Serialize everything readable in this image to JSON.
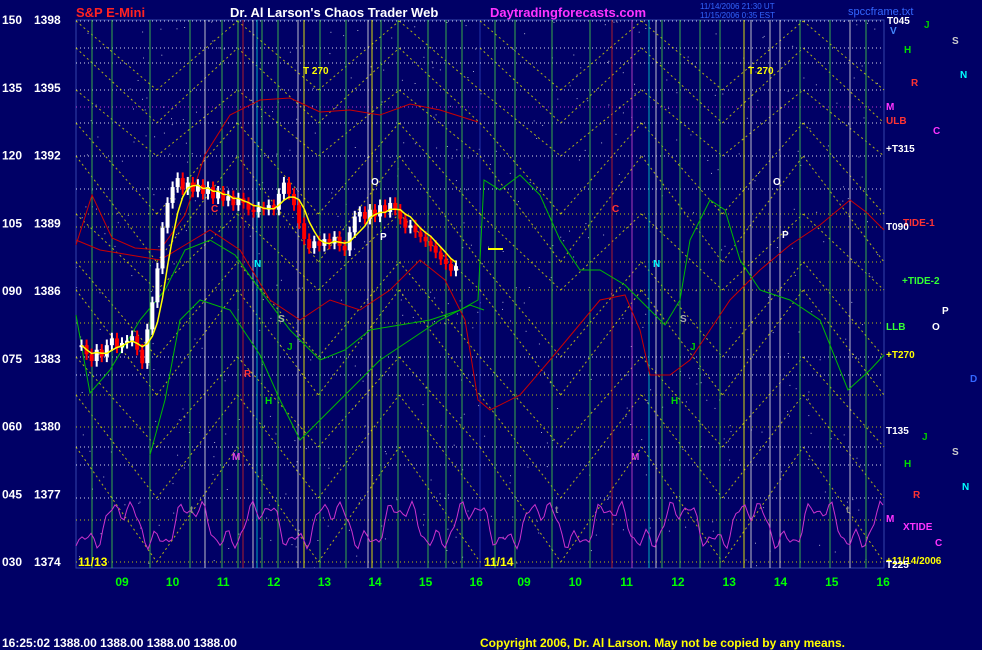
{
  "header": {
    "instrument": "S&P E-Mini",
    "title": "Dr. Al Larson's Chaos Trader Web",
    "website": "Daytradingforecasts.com",
    "stamp_line1": "11/14/2006 21:30 UT",
    "stamp_line2": "11/15/2006 0:35 EST",
    "filename": "spccframe.txt"
  },
  "footer": {
    "quote": "16:25:02  1388.00  1388.00  1388.00  1388.00",
    "copyright": "Copyright 2006, Dr. Al Larson. May not be copied by any means."
  },
  "colors": {
    "background": "#000066",
    "price_up": "#ffffff",
    "price_down": "#ff0000",
    "moving_average": "#ffff00",
    "red_field": "#cc0000",
    "green_field": "#00bb00",
    "xtide": "#cc33cc",
    "grid_green": "#44cc44",
    "grid_yellow": "#dddd00",
    "grid_white": "#ffffff",
    "grid_magenta": "#dd44dd"
  },
  "chart_data": {
    "type": "candlestick",
    "y_axis": {
      "labels": [
        {
          "angle": "150",
          "price": "1398"
        },
        {
          "angle": "135",
          "price": "1395"
        },
        {
          "angle": "120",
          "price": "1392"
        },
        {
          "angle": "105",
          "price": "1389"
        },
        {
          "angle": "090",
          "price": "1386"
        },
        {
          "angle": "075",
          "price": "1383"
        },
        {
          "angle": "060",
          "price": "1380"
        },
        {
          "angle": "045",
          "price": "1377"
        },
        {
          "angle": "030",
          "price": "1374"
        }
      ],
      "price_range": [
        1374,
        1398
      ]
    },
    "x_axis": {
      "day1_label": "11/13",
      "day2_label": "11/14",
      "day1_hours": [
        "09",
        "10",
        "11",
        "12",
        "13",
        "14",
        "15",
        "16"
      ],
      "day2_hours": [
        "09",
        "10",
        "11",
        "12",
        "13",
        "14",
        "15",
        "16"
      ]
    },
    "price_bars": [
      [
        8.2,
        1383.6
      ],
      [
        8.3,
        1383.2
      ],
      [
        8.4,
        1382.9
      ],
      [
        8.5,
        1383.4
      ],
      [
        8.6,
        1383.1
      ],
      [
        8.7,
        1383.6
      ],
      [
        8.8,
        1383.9
      ],
      [
        8.9,
        1383.5
      ],
      [
        9.0,
        1383.7
      ],
      [
        9.1,
        1383.8
      ],
      [
        9.2,
        1384.0
      ],
      [
        9.3,
        1383.4
      ],
      [
        9.4,
        1382.8
      ],
      [
        9.5,
        1384.3
      ],
      [
        9.6,
        1385.5
      ],
      [
        9.7,
        1387.0
      ],
      [
        9.8,
        1388.8
      ],
      [
        9.9,
        1389.9
      ],
      [
        10.0,
        1390.6
      ],
      [
        10.1,
        1391.0
      ],
      [
        10.2,
        1390.5
      ],
      [
        10.3,
        1390.8
      ],
      [
        10.4,
        1390.4
      ],
      [
        10.5,
        1390.7
      ],
      [
        10.6,
        1390.3
      ],
      [
        10.7,
        1390.6
      ],
      [
        10.8,
        1390.1
      ],
      [
        10.9,
        1390.4
      ],
      [
        11.0,
        1390.0
      ],
      [
        11.1,
        1390.2
      ],
      [
        11.2,
        1389.8
      ],
      [
        11.3,
        1390.1
      ],
      [
        11.4,
        1389.9
      ],
      [
        11.5,
        1389.6
      ],
      [
        11.6,
        1389.5
      ],
      [
        11.7,
        1389.7
      ],
      [
        11.8,
        1389.6
      ],
      [
        11.9,
        1389.8
      ],
      [
        12.0,
        1389.6
      ],
      [
        12.1,
        1390.3
      ],
      [
        12.2,
        1390.8
      ],
      [
        12.3,
        1390.3
      ],
      [
        12.4,
        1389.8
      ],
      [
        12.5,
        1389.0
      ],
      [
        12.6,
        1388.3
      ],
      [
        12.7,
        1387.9
      ],
      [
        12.8,
        1388.2
      ],
      [
        12.9,
        1388.0
      ],
      [
        13.0,
        1388.3
      ],
      [
        13.1,
        1388.1
      ],
      [
        13.2,
        1388.4
      ],
      [
        13.3,
        1388.0
      ],
      [
        13.4,
        1387.8
      ],
      [
        13.5,
        1388.6
      ],
      [
        13.6,
        1389.3
      ],
      [
        13.7,
        1389.5
      ],
      [
        13.8,
        1389.2
      ],
      [
        13.9,
        1389.6
      ],
      [
        14.0,
        1389.3
      ],
      [
        14.1,
        1389.8
      ],
      [
        14.2,
        1389.5
      ],
      [
        14.3,
        1389.9
      ],
      [
        14.4,
        1389.6
      ],
      [
        14.5,
        1389.2
      ],
      [
        14.6,
        1388.8
      ],
      [
        14.7,
        1388.9
      ],
      [
        14.8,
        1388.6
      ],
      [
        14.9,
        1388.4
      ],
      [
        15.0,
        1388.2
      ],
      [
        15.1,
        1388.0
      ],
      [
        15.2,
        1387.7
      ],
      [
        15.3,
        1387.4
      ],
      [
        15.4,
        1387.2
      ],
      [
        15.5,
        1386.9
      ],
      [
        15.6,
        1387.1
      ]
    ],
    "annotations": [
      {
        "text": "T 270",
        "color": "#ffff00"
      },
      {
        "text": "T 270",
        "color": "#ffff00"
      },
      {
        "text": "O",
        "color": "#ffffff"
      },
      {
        "text": "O",
        "color": "#ffffff"
      },
      {
        "text": "P",
        "color": "#ffffff"
      },
      {
        "text": "P",
        "color": "#ffffff"
      },
      {
        "text": "N",
        "color": "#00ffff"
      },
      {
        "text": "N",
        "color": "#00ffff"
      },
      {
        "text": "S",
        "color": "#aaaaaa"
      },
      {
        "text": "S",
        "color": "#aaaaaa"
      },
      {
        "text": "J",
        "color": "#00cc00"
      },
      {
        "text": "J",
        "color": "#00cc00"
      },
      {
        "text": "H",
        "color": "#00dd00"
      },
      {
        "text": "H",
        "color": "#00dd00"
      },
      {
        "text": "M",
        "color": "#dd44dd"
      },
      {
        "text": "M",
        "color": "#dd44dd"
      },
      {
        "text": "C",
        "color": "#ff3333"
      },
      {
        "text": "C",
        "color": "#ff3333"
      },
      {
        "text": "R",
        "color": "#ff3333"
      },
      {
        "text": "t",
        "color": "#888888"
      },
      {
        "text": "t",
        "color": "#888888"
      },
      {
        "text": "t",
        "color": "#888888"
      }
    ],
    "right_labels": [
      {
        "text": "T045",
        "color": "#ffffff"
      },
      {
        "text": "V",
        "color": "#4488ff"
      },
      {
        "text": "J",
        "color": "#00cc00"
      },
      {
        "text": "S",
        "color": "#cccccc"
      },
      {
        "text": "H",
        "color": "#00dd00"
      },
      {
        "text": "N",
        "color": "#00ffff"
      },
      {
        "text": "R",
        "color": "#ff3333"
      },
      {
        "text": "M",
        "color": "#ff33ff"
      },
      {
        "text": "ULB",
        "color": "#ff3333"
      },
      {
        "text": "C",
        "color": "#ff33ff"
      },
      {
        "text": "+T315",
        "color": "#ffffff"
      },
      {
        "text": "TIDE-1",
        "color": "#ff3333"
      },
      {
        "text": "T090",
        "color": "#ffffff"
      },
      {
        "text": "+TIDE-2",
        "color": "#33ff33"
      },
      {
        "text": "LLB",
        "color": "#33ff33"
      },
      {
        "text": "O",
        "color": "#ffffff"
      },
      {
        "text": "P",
        "color": "#ffffff"
      },
      {
        "text": "+T270",
        "color": "#ffff00"
      },
      {
        "text": "D",
        "color": "#3366ff"
      },
      {
        "text": "T135",
        "color": "#ffffff"
      },
      {
        "text": "J",
        "color": "#00cc00"
      },
      {
        "text": "S",
        "color": "#cccccc"
      },
      {
        "text": "H",
        "color": "#00dd00"
      },
      {
        "text": "N",
        "color": "#00ffff"
      },
      {
        "text": "R",
        "color": "#ff3333"
      },
      {
        "text": "M",
        "color": "#ff33ff"
      },
      {
        "text": "XTIDE",
        "color": "#ff33ff"
      },
      {
        "text": "C",
        "color": "#ff33ff"
      },
      {
        "text": "+11/14/2006",
        "color": "#ffff00"
      },
      {
        "text": "T225",
        "color": "#ffffff"
      }
    ]
  }
}
